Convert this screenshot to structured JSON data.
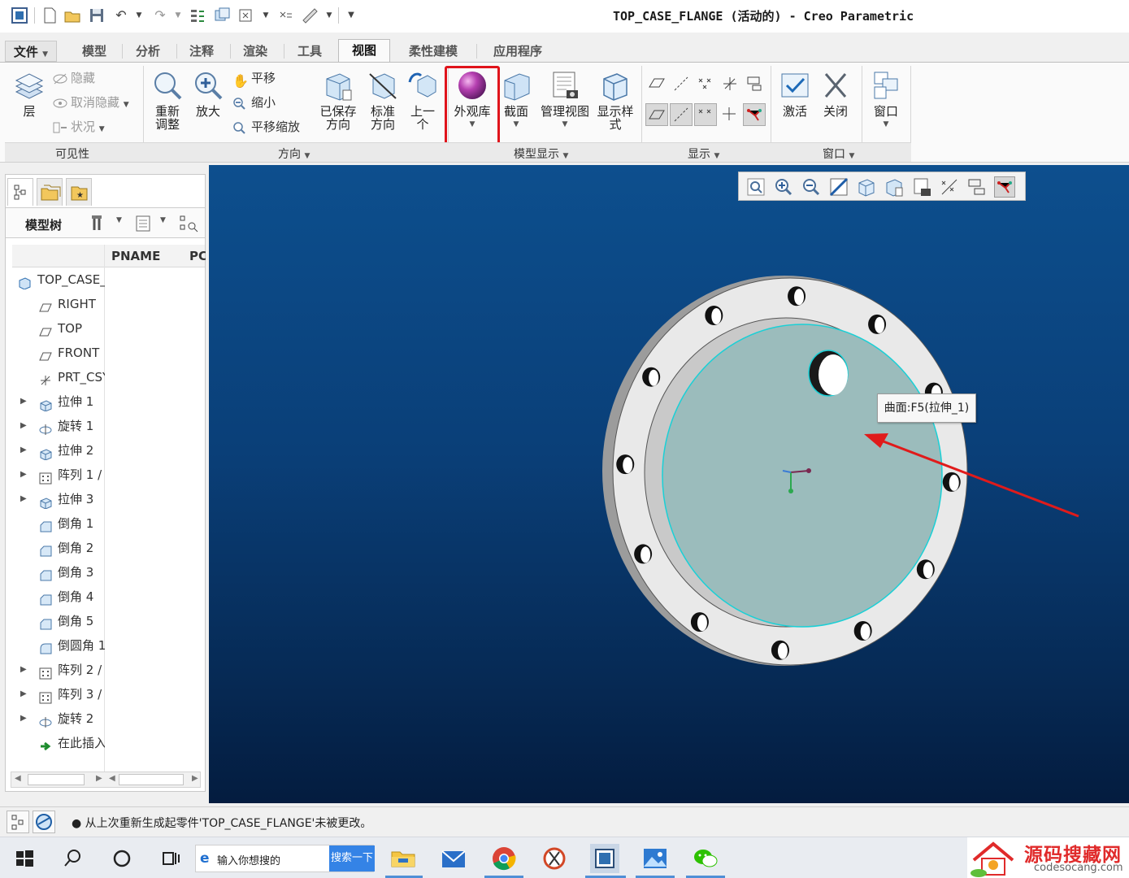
{
  "window": {
    "title": "TOP_CASE_FLANGE (活动的) - Creo Parametric"
  },
  "quick_access": {
    "icons": [
      "app-icon",
      "new-icon",
      "open-icon",
      "save-icon",
      "undo-icon",
      "redo-icon",
      "regenerate-icon",
      "windows-icon",
      "close-window-icon",
      "measure-icon",
      "customize-icon"
    ]
  },
  "ribbon_tabs": [
    {
      "label": "文件",
      "active": false
    },
    {
      "label": "模型",
      "active": false
    },
    {
      "label": "分析",
      "active": false
    },
    {
      "label": "注释",
      "active": false
    },
    {
      "label": "渲染",
      "active": false
    },
    {
      "label": "工具",
      "active": false
    },
    {
      "label": "视图",
      "active": true
    },
    {
      "label": "柔性建模",
      "active": false
    },
    {
      "label": "应用程序",
      "active": false
    }
  ],
  "ribbon": {
    "visibility": {
      "layer": "层",
      "hide": "隐藏",
      "unhide": "取消隐藏",
      "status": "状况",
      "group_label": "可见性"
    },
    "orientation": {
      "refit": "重新调整",
      "zoom_in": "放大",
      "pan": "平移",
      "zoom_out": "缩小",
      "pan_zoom": "平移缩放",
      "saved_orientations": "已保存方向",
      "standard_orientation": "标准方向",
      "previous": "上一个",
      "group_label": "方向"
    },
    "model_display": {
      "appearance_gallery": "外观库",
      "section": "截面",
      "manage_views": "管理视图",
      "display_style": "显示样式",
      "group_label": "模型显示"
    },
    "show": {
      "group_label": "显示"
    },
    "window": {
      "activate": "激活",
      "close": "关闭",
      "windows": "窗口",
      "group_label": "窗口"
    },
    "highlight_color": "#e0141b"
  },
  "model_tree": {
    "title": "模型树",
    "columns": [
      "PNAME",
      "PC"
    ],
    "items": [
      {
        "label": "TOP_CASE_F",
        "icon": "part-icon",
        "expandable": false,
        "indent": 0
      },
      {
        "label": "RIGHT",
        "icon": "datum-plane-icon",
        "expandable": false,
        "indent": 1
      },
      {
        "label": "TOP",
        "icon": "datum-plane-icon",
        "expandable": false,
        "indent": 1
      },
      {
        "label": "FRONT",
        "icon": "datum-plane-icon",
        "expandable": false,
        "indent": 1
      },
      {
        "label": "PRT_CSYS",
        "icon": "csys-icon",
        "expandable": false,
        "indent": 1
      },
      {
        "label": "拉伸 1",
        "icon": "extrude-icon",
        "expandable": true,
        "indent": 1
      },
      {
        "label": "旋转 1",
        "icon": "revolve-icon",
        "expandable": true,
        "indent": 1
      },
      {
        "label": "拉伸 2",
        "icon": "extrude-icon",
        "expandable": true,
        "indent": 1
      },
      {
        "label": "阵列 1 /",
        "icon": "pattern-icon",
        "expandable": true,
        "indent": 1
      },
      {
        "label": "拉伸 3",
        "icon": "extrude-icon",
        "expandable": true,
        "indent": 1
      },
      {
        "label": "倒角 1",
        "icon": "chamfer-icon",
        "expandable": false,
        "indent": 1
      },
      {
        "label": "倒角 2",
        "icon": "chamfer-icon",
        "expandable": false,
        "indent": 1
      },
      {
        "label": "倒角 3",
        "icon": "chamfer-icon",
        "expandable": false,
        "indent": 1
      },
      {
        "label": "倒角 4",
        "icon": "chamfer-icon",
        "expandable": false,
        "indent": 1
      },
      {
        "label": "倒角 5",
        "icon": "chamfer-icon",
        "expandable": false,
        "indent": 1
      },
      {
        "label": "倒圆角 1",
        "icon": "round-icon",
        "expandable": false,
        "indent": 1
      },
      {
        "label": "阵列 2 /",
        "icon": "pattern-icon",
        "expandable": true,
        "indent": 1
      },
      {
        "label": "阵列 3 /",
        "icon": "pattern-icon",
        "expandable": true,
        "indent": 1
      },
      {
        "label": "旋转 2",
        "icon": "revolve-icon",
        "expandable": true,
        "indent": 1
      },
      {
        "label": "在此插入",
        "icon": "insert-here-icon",
        "expandable": false,
        "indent": 1
      }
    ]
  },
  "viewport": {
    "tooltip": "曲面:F5(拉伸_1)",
    "background_top": "#0d4f8e",
    "background_bottom": "#041c3f",
    "surface_color": "#9bbcbc",
    "flange_color": "#e8e8e8"
  },
  "status_bar": {
    "message": "从上次重新生成起零件'TOP_CASE_FLANGE'未被更改。"
  },
  "taskbar": {
    "search_placeholder": "输入你想搜的",
    "search_button": "搜索一下"
  },
  "watermark": {
    "text": "源码搜藏网",
    "url": "codesocang.com"
  }
}
